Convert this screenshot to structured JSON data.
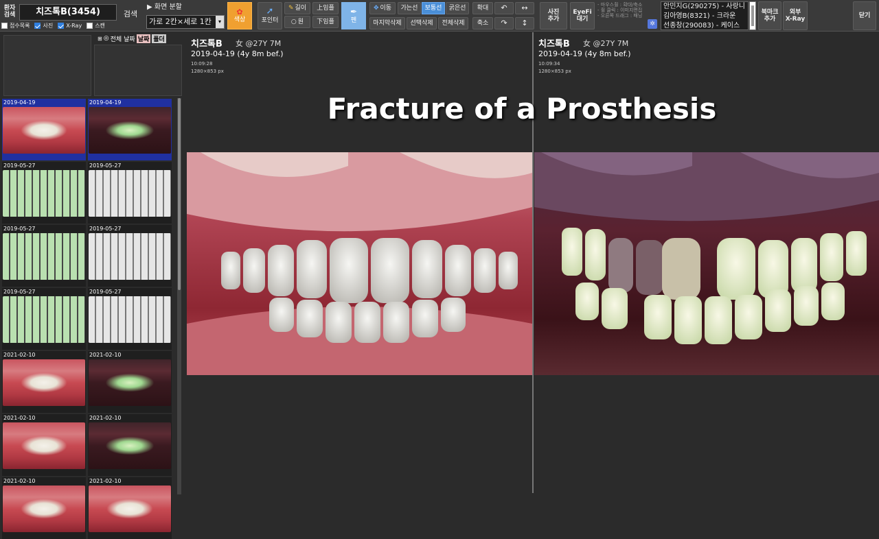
{
  "search": {
    "label": "환자\n검색",
    "patient_value": "치즈톡B(3454)",
    "search_button": "검색",
    "filters": [
      {
        "label": "접수목록",
        "checked": false
      },
      {
        "label": "사진",
        "checked": true
      },
      {
        "label": "X-Ray",
        "checked": true
      },
      {
        "label": "스캔",
        "checked": false
      }
    ]
  },
  "layout": {
    "label": "▶ 화면 분할",
    "value": "가로 2칸×세로 1칸"
  },
  "toolbar": {
    "color": "색상",
    "pointer": "포인터",
    "length": "길이",
    "circle": "원",
    "upper": "上임플",
    "lower": "下임플",
    "pen": "펜",
    "move": "이동",
    "thin_line": "가는선",
    "normal_line": "보통선",
    "thick_line": "굵은선",
    "delete_last": "마지막삭제",
    "delete_selected": "선택삭제",
    "delete_all": "전체삭제",
    "zoom_in": "확대",
    "zoom_out": "축소",
    "rotate_left": "↶",
    "rotate_right": "↷",
    "flip_h": "↔",
    "flip_v": "↕",
    "add_photo": "사진\n추가",
    "eyefi": "EyeFi\n대기",
    "help": "- 마우스휠 : 확대/축소\n- 휠 클릭 : 이미지편집\n- 오른쪽 드래그 : 패닝",
    "bookmark_add": "북마크\n추가",
    "external_xray": "외부\nX-Ray",
    "close": "닫기"
  },
  "patient_list": [
    "안민지G(290275) - 사랑니",
    "김아영B(8321) - 크라운",
    "선종창(290083) - 케이스"
  ],
  "left_header": {
    "all_label": "전체",
    "date_button": "날짜",
    "folder_button": "폴더"
  },
  "thumbnails": [
    {
      "date": "2019-04-19",
      "style": "normal"
    },
    {
      "date": "2019-04-19",
      "style": "dark"
    },
    {
      "date": "2019-05-27",
      "style": "brace-dark"
    },
    {
      "date": "2019-05-27",
      "style": "brace"
    },
    {
      "date": "2019-05-27",
      "style": "brace-dark"
    },
    {
      "date": "2019-05-27",
      "style": "brace"
    },
    {
      "date": "2019-05-27",
      "style": "brace-dark"
    },
    {
      "date": "2019-05-27",
      "style": "brace"
    },
    {
      "date": "2021-02-10",
      "style": "normal"
    },
    {
      "date": "2021-02-10",
      "style": "dark"
    },
    {
      "date": "2021-02-10",
      "style": "normal"
    },
    {
      "date": "2021-02-10",
      "style": "dark"
    },
    {
      "date": "2021-02-10",
      "style": "normal"
    },
    {
      "date": "2021-02-10",
      "style": "normal"
    }
  ],
  "viewer_left": {
    "name": "치즈톡B",
    "sub": "女 @27Y 7M",
    "date": "2019-04-19 (4y 8m bef.)",
    "time": "10:09:28",
    "size": "1280×853 px"
  },
  "viewer_right": {
    "name": "치즈톡B",
    "sub": "女 @27Y 7M",
    "date": "2019-04-19 (4y 8m bef.)",
    "time": "10:09:34",
    "size": "1280×853 px"
  },
  "overlay_title": "Fracture of a Prosthesis",
  "colors": {
    "accent_orange": "#f0a030",
    "accent_blue": "#4a8fd8",
    "selected_border": "#2030a0"
  }
}
